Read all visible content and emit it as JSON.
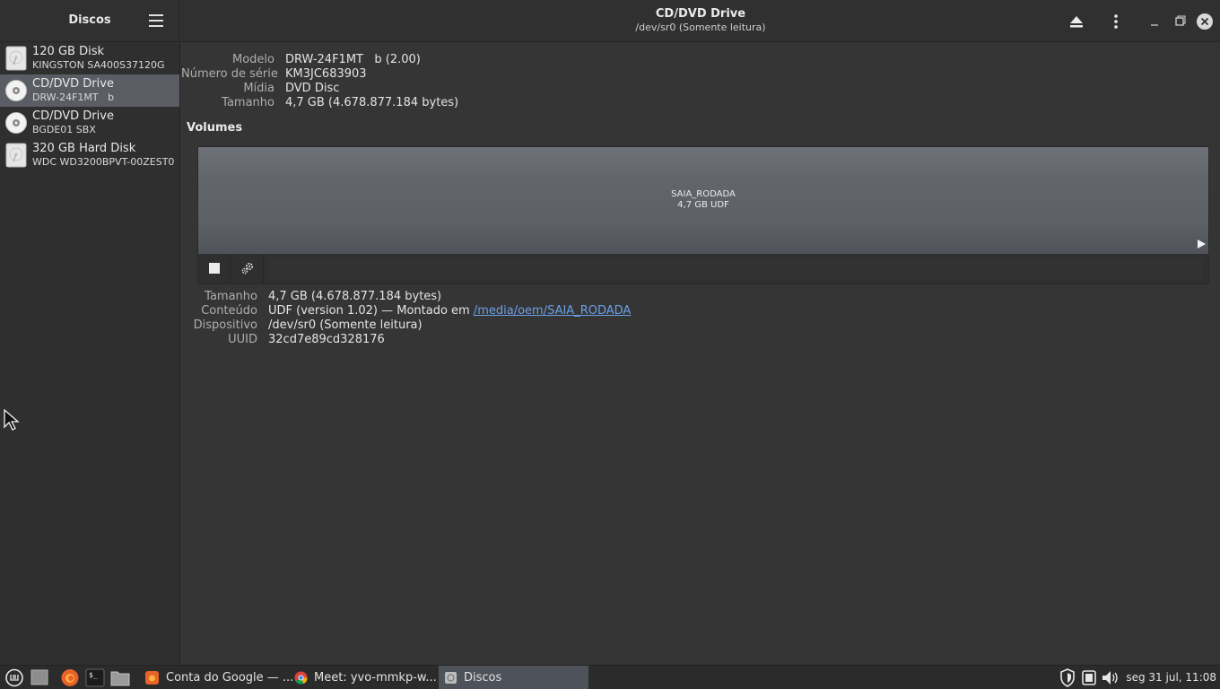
{
  "sidebar": {
    "title": "Discos",
    "disks": [
      {
        "name": "120 GB Disk",
        "model": "KINGSTON SA400S37120G",
        "icon": "hard-disk-icon"
      },
      {
        "name": "CD/DVD Drive",
        "model": "DRW-24F1MT   b",
        "icon": "optical-disc-icon"
      },
      {
        "name": "CD/DVD Drive",
        "model": "BGDE01 SBX",
        "icon": "optical-disc-icon"
      },
      {
        "name": "320 GB Hard Disk",
        "model": "WDC WD3200BPVT-00ZEST0",
        "icon": "hard-disk-icon"
      }
    ]
  },
  "header": {
    "title": "CD/DVD Drive",
    "subtitle": "/dev/sr0 (Somente leitura)"
  },
  "drive": {
    "rows": [
      {
        "label": "Modelo",
        "value": "DRW-24F1MT   b (2.00)"
      },
      {
        "label": "Número de série",
        "value": "KM3JC683903"
      },
      {
        "label": "Mídia",
        "value": "DVD Disc"
      },
      {
        "label": "Tamanho",
        "value": "4,7 GB (4.678.877.184 bytes)"
      }
    ]
  },
  "volumes": {
    "title": "Volumes",
    "volume_name": "SAIA_RODADA",
    "volume_size": "4,7 GB UDF"
  },
  "volume_details": {
    "size_label": "Tamanho",
    "size_value": "4,7 GB (4.678.877.184 bytes)",
    "content_label": "Conteúdo",
    "content_prefix": "UDF (version 1.02) — Montado em ",
    "content_link": "/media/oem/SAIA_RODADA",
    "device_label": "Dispositivo",
    "device_value": "/dev/sr0 (Somente leitura)",
    "uuid_label": "UUID",
    "uuid_value": "32cd7e89cd328176"
  },
  "taskbar": {
    "windows": [
      {
        "label": "Conta do Google — ...",
        "icon": "firefox-icon"
      },
      {
        "label": "Meet: yvo-mmkp-w...",
        "icon": "chrome-icon"
      },
      {
        "label": "Discos",
        "icon": "disks-icon"
      }
    ],
    "clock": "seg 31 jul, 11:08"
  },
  "colors": {
    "selected_row": "#5a5d63",
    "link": "#6aa0e6",
    "firefox": "#e8622a",
    "active_task": "#4e535b"
  }
}
